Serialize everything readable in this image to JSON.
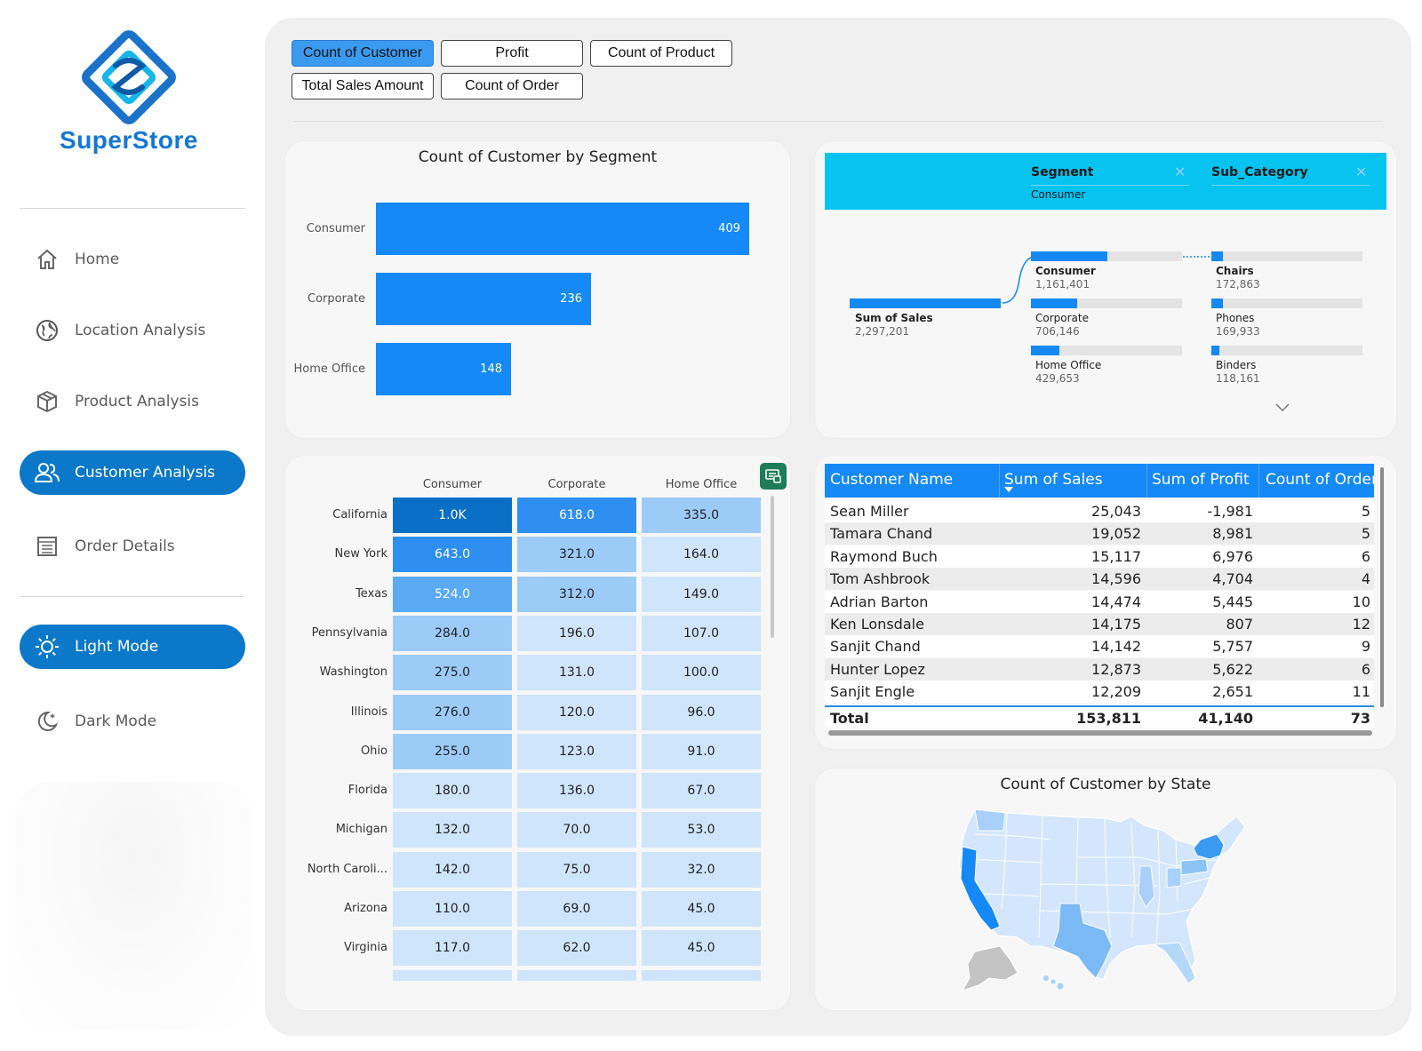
{
  "brand": {
    "name": "SuperStore"
  },
  "colors": {
    "accent": "#0b78c9",
    "bar": "#1589f5",
    "header": "#06c3f0"
  },
  "nav": {
    "items": [
      {
        "label": "Home",
        "icon": "home-icon"
      },
      {
        "label": "Location Analysis",
        "icon": "globe-icon"
      },
      {
        "label": "Product Analysis",
        "icon": "box-icon"
      },
      {
        "label": "Customer Analysis",
        "icon": "users-icon",
        "active": true
      },
      {
        "label": "Order Details",
        "icon": "list-icon"
      }
    ],
    "modes": [
      {
        "label": "Light Mode",
        "icon": "sun-icon",
        "active": true
      },
      {
        "label": "Dark Mode",
        "icon": "moon-icon"
      }
    ]
  },
  "buttons": {
    "count_customer": "Count of Customer",
    "profit": "Profit",
    "count_product": "Count of Product",
    "total_sales": "Total Sales Amount",
    "count_order": "Count of Order"
  },
  "chart_data": {
    "type": "bar",
    "title": "Count of Customer by Segment",
    "orientation": "horizontal",
    "categories": [
      "Consumer",
      "Corporate",
      "Home Office"
    ],
    "values": [
      409,
      236,
      148
    ],
    "xlim": [
      0,
      409
    ]
  },
  "matrix": {
    "columns": [
      "Consumer",
      "Corporate",
      "Home Office"
    ],
    "rows": [
      {
        "state": "California",
        "values": [
          "1.0K",
          "618.0",
          "335.0"
        ],
        "raw": [
          1000,
          618,
          335
        ]
      },
      {
        "state": "New York",
        "values": [
          "643.0",
          "321.0",
          "164.0"
        ],
        "raw": [
          643,
          321,
          164
        ]
      },
      {
        "state": "Texas",
        "values": [
          "524.0",
          "312.0",
          "149.0"
        ],
        "raw": [
          524,
          312,
          149
        ]
      },
      {
        "state": "Pennsylvania",
        "values": [
          "284.0",
          "196.0",
          "107.0"
        ],
        "raw": [
          284,
          196,
          107
        ]
      },
      {
        "state": "Washington",
        "values": [
          "275.0",
          "131.0",
          "100.0"
        ],
        "raw": [
          275,
          131,
          100
        ]
      },
      {
        "state": "Illinois",
        "values": [
          "276.0",
          "120.0",
          "96.0"
        ],
        "raw": [
          276,
          120,
          96
        ]
      },
      {
        "state": "Ohio",
        "values": [
          "255.0",
          "123.0",
          "91.0"
        ],
        "raw": [
          255,
          123,
          91
        ]
      },
      {
        "state": "Florida",
        "values": [
          "180.0",
          "136.0",
          "67.0"
        ],
        "raw": [
          180,
          136,
          67
        ]
      },
      {
        "state": "Michigan",
        "values": [
          "132.0",
          "70.0",
          "53.0"
        ],
        "raw": [
          132,
          70,
          53
        ]
      },
      {
        "state": "North Caroli...",
        "values": [
          "142.0",
          "75.0",
          "32.0"
        ],
        "raw": [
          142,
          75,
          32
        ]
      },
      {
        "state": "Arizona",
        "values": [
          "110.0",
          "69.0",
          "45.0"
        ],
        "raw": [
          110,
          69,
          45
        ]
      },
      {
        "state": "Virginia",
        "values": [
          "117.0",
          "62.0",
          "45.0"
        ],
        "raw": [
          117,
          62,
          45
        ]
      }
    ]
  },
  "decomp": {
    "header": {
      "segment": "Segment",
      "segment_value": "Consumer",
      "sub_category": "Sub_Category"
    },
    "root": {
      "label": "Sum of Sales",
      "value": "2,297,201"
    },
    "level1": [
      {
        "label": "Consumer",
        "value": "1,161,401",
        "share": 0.505
      },
      {
        "label": "Corporate",
        "value": "706,146",
        "share": 0.307
      },
      {
        "label": "Home Office",
        "value": "429,653",
        "share": 0.187
      }
    ],
    "level2": [
      {
        "label": "Chairs",
        "value": "172,863",
        "share": 0.075
      },
      {
        "label": "Phones",
        "value": "169,933",
        "share": 0.074
      },
      {
        "label": "Binders",
        "value": "118,161",
        "share": 0.051
      }
    ]
  },
  "customers": {
    "columns": [
      "Customer Name",
      "Sum of Sales",
      "Sum of Profit",
      "Count of Order"
    ],
    "rows": [
      [
        "Sean Miller",
        "25,043",
        "-1,981",
        "5"
      ],
      [
        "Tamara Chand",
        "19,052",
        "8,981",
        "5"
      ],
      [
        "Raymond Buch",
        "15,117",
        "6,976",
        "6"
      ],
      [
        "Tom Ashbrook",
        "14,596",
        "4,704",
        "4"
      ],
      [
        "Adrian Barton",
        "14,474",
        "5,445",
        "10"
      ],
      [
        "Ken Lonsdale",
        "14,175",
        "807",
        "12"
      ],
      [
        "Sanjit Chand",
        "14,142",
        "5,757",
        "9"
      ],
      [
        "Hunter Lopez",
        "12,873",
        "5,622",
        "6"
      ],
      [
        "Sanjit Engle",
        "12,209",
        "2,651",
        "11"
      ]
    ],
    "total": [
      "Total",
      "153,811",
      "41,140",
      "73"
    ]
  },
  "map": {
    "title": "Count of Customer by State"
  }
}
